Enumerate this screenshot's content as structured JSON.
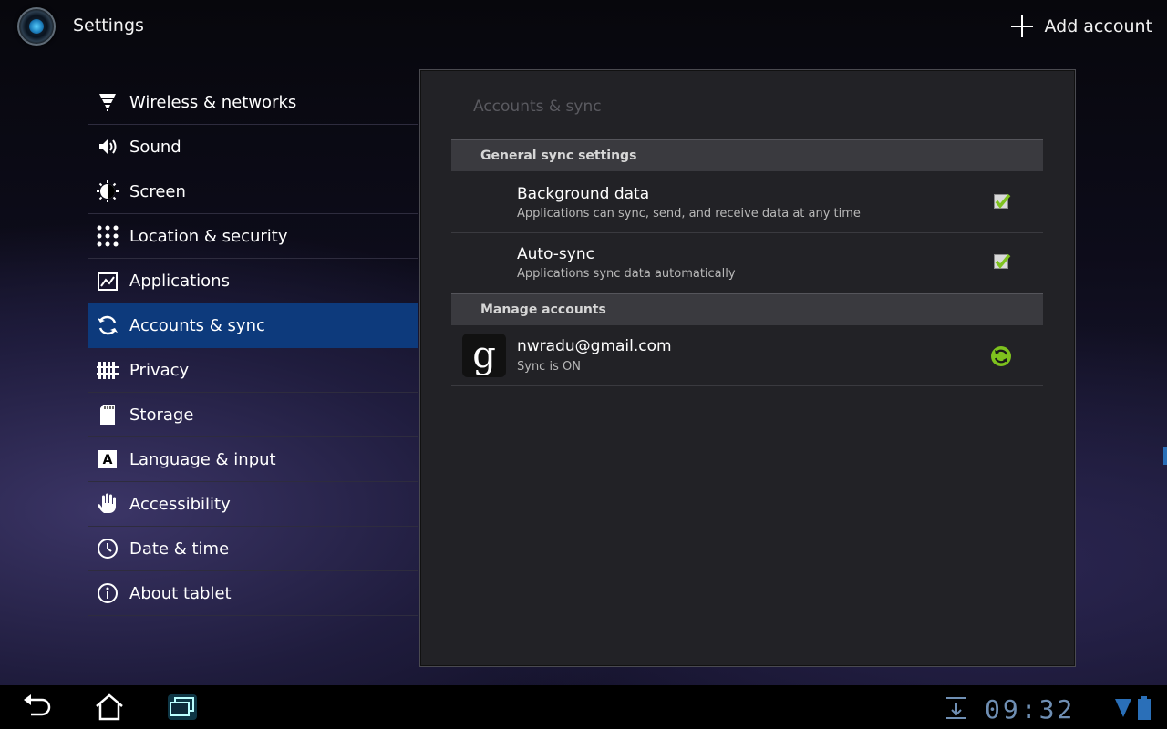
{
  "actionbar": {
    "title": "Settings",
    "add_account_label": "Add account"
  },
  "menu": {
    "items": [
      {
        "label": "Wireless & networks",
        "icon": "wifi-icon"
      },
      {
        "label": "Sound",
        "icon": "speaker-icon"
      },
      {
        "label": "Screen",
        "icon": "brightness-icon"
      },
      {
        "label": "Location & security",
        "icon": "grid-lock-icon"
      },
      {
        "label": "Applications",
        "icon": "applications-icon"
      },
      {
        "label": "Accounts & sync",
        "icon": "sync-icon",
        "selected": true
      },
      {
        "label": "Privacy",
        "icon": "fence-icon"
      },
      {
        "label": "Storage",
        "icon": "sd-card-icon"
      },
      {
        "label": "Language & input",
        "icon": "keyboard-letter-icon"
      },
      {
        "label": "Accessibility",
        "icon": "hand-icon"
      },
      {
        "label": "Date & time",
        "icon": "clock-icon"
      },
      {
        "label": "About tablet",
        "icon": "info-icon"
      }
    ]
  },
  "panel": {
    "title": "Accounts & sync",
    "general_header": "General sync settings",
    "background_data": {
      "title": "Background data",
      "summary": "Applications can sync, send, and receive data at any time",
      "checked": true
    },
    "auto_sync": {
      "title": "Auto-sync",
      "summary": "Applications sync data automatically",
      "checked": true
    },
    "manage_header": "Manage accounts",
    "account": {
      "avatar_letter": "g",
      "email": "nwradu@gmail.com",
      "status": "Sync is ON"
    }
  },
  "sysbar": {
    "clock": "09:32"
  },
  "colors": {
    "selected": "#0d3a7c",
    "check": "#7ec21e",
    "clock": "#6f8fb4"
  }
}
